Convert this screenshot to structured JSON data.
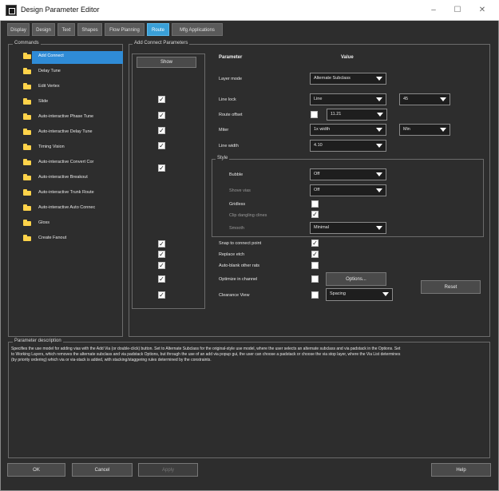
{
  "window": {
    "title": "Design Parameter Editor"
  },
  "tabs": [
    "Display",
    "Design",
    "Text",
    "Shapes",
    "Flow Planning",
    "Route",
    "Mfg Applications"
  ],
  "active_tab": "Route",
  "commands": {
    "label": "Commands",
    "items": [
      "Add Connect",
      "Delay Tune",
      "Edit Vertex",
      "Slide",
      "Auto-interactive Phase Tune",
      "Auto-interactive Delay Tune",
      "Timing Vision",
      "Auto-interactive Convert Cor",
      "Auto-interactive Breakout",
      "Auto-interactive Trunk Route",
      "Auto-interactive Auto Connec",
      "Gloss",
      "Create Fanout"
    ],
    "selected": "Add Connect"
  },
  "params": {
    "label": "Add Connect Parameters",
    "show_label": "Show",
    "header_parameter": "Parameter",
    "header_value": "Value",
    "layer_mode": {
      "label": "Layer mode",
      "value": "Alternate Subclass"
    },
    "line_lock": {
      "label": "Line lock",
      "value": "Line",
      "value2": "45"
    },
    "route_offset": {
      "label": "Route offset",
      "value": "11.21"
    },
    "miter": {
      "label": "Miter",
      "value": "1x width",
      "value2": "Min"
    },
    "line_width": {
      "label": "Line width",
      "value": "4.10"
    },
    "style": {
      "label": "Style",
      "bubble": {
        "label": "Bubble",
        "value": "Off"
      },
      "shove_vias": {
        "label": "Shove vias",
        "value": "Off"
      },
      "gridless": {
        "label": "Gridless"
      },
      "clip_dangling": {
        "label": "Clip dangling clines",
        "check": "✓"
      },
      "smooth": {
        "label": "Smooth",
        "value": "Minimal"
      }
    },
    "snap": {
      "label": "Snap to connect point",
      "check": "✓"
    },
    "replace_etch": {
      "label": "Replace etch",
      "check": "✓"
    },
    "auto_blank": {
      "label": "Auto-blank other rats"
    },
    "optimize": {
      "label": "Optimize in channel",
      "options_label": "Options..."
    },
    "clearance": {
      "label": "Clearance View",
      "value": "Spacing"
    },
    "reset_label": "Reset",
    "show_check": "✓"
  },
  "description": {
    "label": "Parameter description",
    "text": "Specifies the use model for adding vias with the Add Via (or double-click) button.  Set to Alternate Subclass for the original-style use model, where the user selects an alternate subclass and via padstack in the Options.  Set to Working Layers, which removes the alternate subclass and via padstack Options, but through the use of an add via popup gui, the user can choose a padstack or choose the via stop layer, where the Via List determines (by priority ordering) which via or via-stack is added, with stacking/staggering rules determined by the constraints."
  },
  "buttons": {
    "ok": "OK",
    "cancel": "Cancel",
    "apply": "Apply",
    "help": "Help"
  }
}
